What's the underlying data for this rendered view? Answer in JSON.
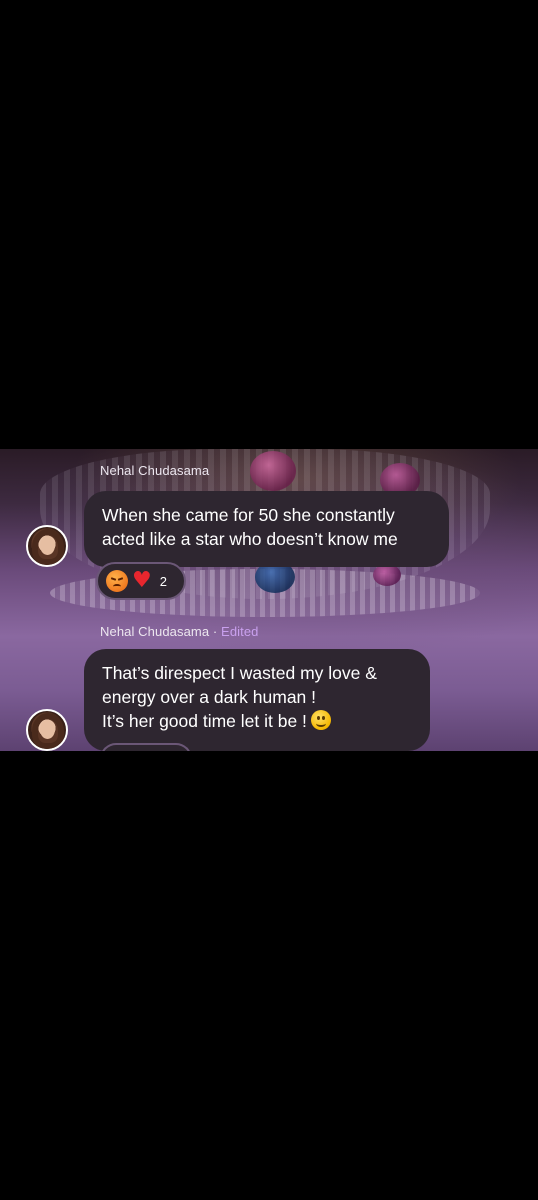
{
  "messages": [
    {
      "author": "Nehal Chudasama",
      "edited_label": "",
      "lines": [
        "When she came for 50 she constantly",
        "acted like a star who doesn’t know me"
      ],
      "reactions": {
        "emojis": [
          "angry-face",
          "red-heart"
        ],
        "count": "2"
      }
    },
    {
      "author": "Nehal Chudasama",
      "separator": " · ",
      "edited_label": "Edited",
      "lines": [
        "That’s direspect I wasted my love &",
        "energy over a dark human !",
        "It’s her good time let it be !"
      ],
      "trailing_emoji": "slightly-smiling-face"
    }
  ],
  "colors": {
    "bubble": "#2e2630",
    "edited": "#c9a0ee",
    "heart": "#e8262e"
  }
}
